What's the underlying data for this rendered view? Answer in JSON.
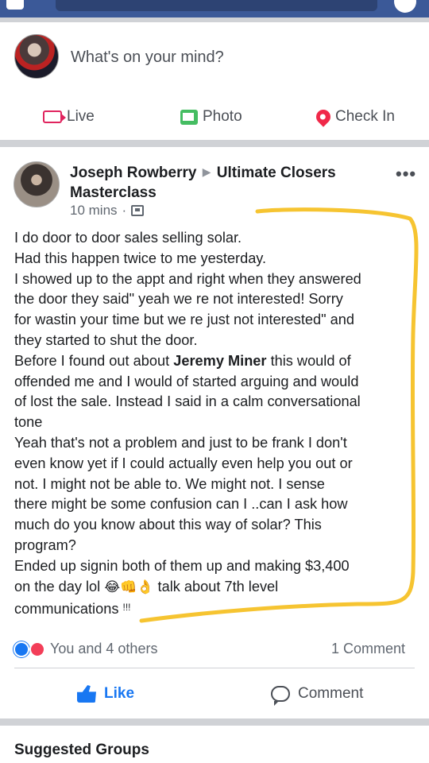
{
  "composer": {
    "prompt": "What's on your mind?"
  },
  "actions": {
    "live": "Live",
    "photo": "Photo",
    "check_in": "Check In"
  },
  "post": {
    "author": "Joseph Rowberry",
    "group": "Ultimate Closers Masterclass",
    "time": "10 mins",
    "separator": "·",
    "lines": [
      "I do door to door sales selling solar.",
      "Had this happen twice to me yesterday.",
      "I showed up to the appt and right when they answered",
      "the door they said\" yeah we re not interested! Sorry",
      "for wastin your time but we re just not interested\" and",
      "they started to shut the door.",
      "Before I found out about",
      "Jeremy Miner",
      "this would of",
      "offended me and I would of started arguing and would",
      "of lost the sale. Instead I said in a calm conversational",
      "tone",
      "Yeah that's not a problem and  just to be frank I don't",
      "even know yet if I could actually even help you out or",
      "not. I might not be able to. We might not.    I sense",
      "there might be some confusion can I ..can I ask how",
      "much do you know about this way of solar? This",
      "program?",
      "Ended up signin both of them up and making $3,400",
      "on the day lol",
      "😂👊👌",
      "talk about 7th level",
      "communications",
      "!!!"
    ]
  },
  "footer": {
    "reactions_text": "You and 4 others",
    "comments_text": "1 Comment",
    "like_label": "Like",
    "comment_label": "Comment"
  },
  "next_section": {
    "title": "Suggested Groups"
  },
  "colors": {
    "brand": "#3b5998",
    "like_blue": "#1877f2",
    "highlight": "#f6c431"
  }
}
